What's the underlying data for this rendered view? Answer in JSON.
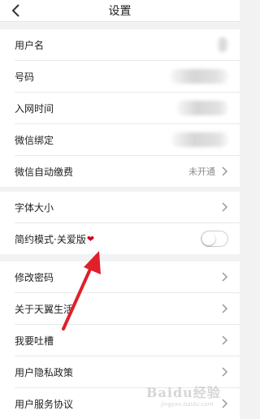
{
  "header": {
    "title": "设置"
  },
  "account": [
    {
      "label": "用户名"
    },
    {
      "label": "号码"
    },
    {
      "label": "入网时间"
    },
    {
      "label": "微信绑定"
    },
    {
      "label": "微信自动缴费",
      "value": "未开通"
    }
  ],
  "settings": {
    "font_size": "字体大小",
    "simple_mode": "简约模式·关爱版",
    "simple_mode_enabled": false
  },
  "more": [
    {
      "label": "修改密码"
    },
    {
      "label": "关于天翼生活"
    },
    {
      "label": "我要吐槽"
    },
    {
      "label": "用户隐私政策"
    },
    {
      "label": "用户服务协议"
    }
  ],
  "watermark": {
    "logo": "Baidu经验",
    "url": "jingyan.baidu.com"
  },
  "colors": {
    "annotation_arrow": "#e0202a",
    "heart": "#d0021b"
  }
}
